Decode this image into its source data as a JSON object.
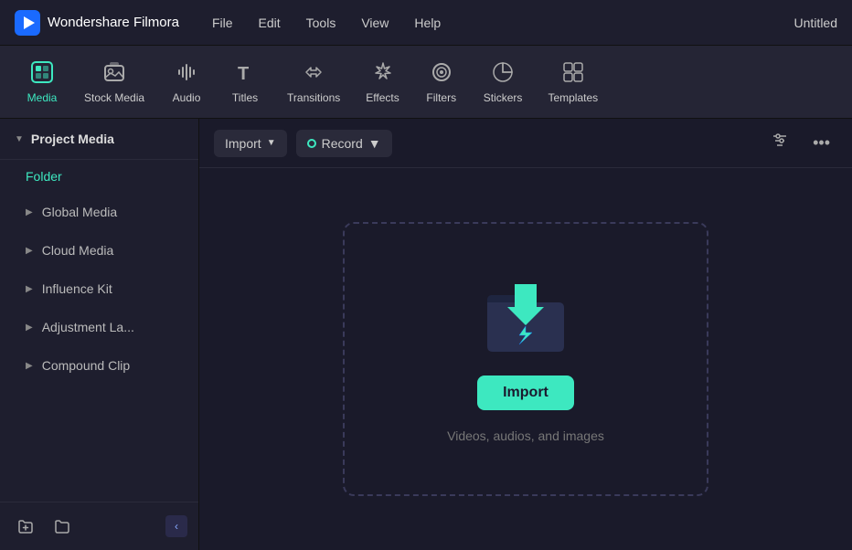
{
  "titleBar": {
    "appName": "Wondershare Filmora",
    "menuItems": [
      "File",
      "Edit",
      "Tools",
      "View",
      "Help"
    ],
    "windowTitle": "Untitled"
  },
  "toolbar": {
    "items": [
      {
        "id": "media",
        "label": "Media",
        "icon": "⊡",
        "active": true
      },
      {
        "id": "stock-media",
        "label": "Stock Media",
        "icon": "📷"
      },
      {
        "id": "audio",
        "label": "Audio",
        "icon": "♪"
      },
      {
        "id": "titles",
        "label": "Titles",
        "icon": "T"
      },
      {
        "id": "transitions",
        "label": "Transitions",
        "icon": "↔"
      },
      {
        "id": "effects",
        "label": "Effects",
        "icon": "✦"
      },
      {
        "id": "filters",
        "label": "Filters",
        "icon": "⦿"
      },
      {
        "id": "stickers",
        "label": "Stickers",
        "icon": "❋"
      },
      {
        "id": "templates",
        "label": "Templates",
        "icon": "⊞"
      }
    ]
  },
  "sidebar": {
    "header": "Project Media",
    "folder": "Folder",
    "items": [
      {
        "id": "global-media",
        "label": "Global Media"
      },
      {
        "id": "cloud-media",
        "label": "Cloud Media"
      },
      {
        "id": "influence-kit",
        "label": "Influence Kit"
      },
      {
        "id": "adjustment-la",
        "label": "Adjustment La..."
      },
      {
        "id": "compound-clip",
        "label": "Compound Clip"
      }
    ]
  },
  "contentToolbar": {
    "importLabel": "Import",
    "recordLabel": "Record",
    "filterIcon": "filter",
    "moreIcon": "more"
  },
  "dropZone": {
    "importButton": "Import",
    "hint": "Videos, audios, and images"
  }
}
